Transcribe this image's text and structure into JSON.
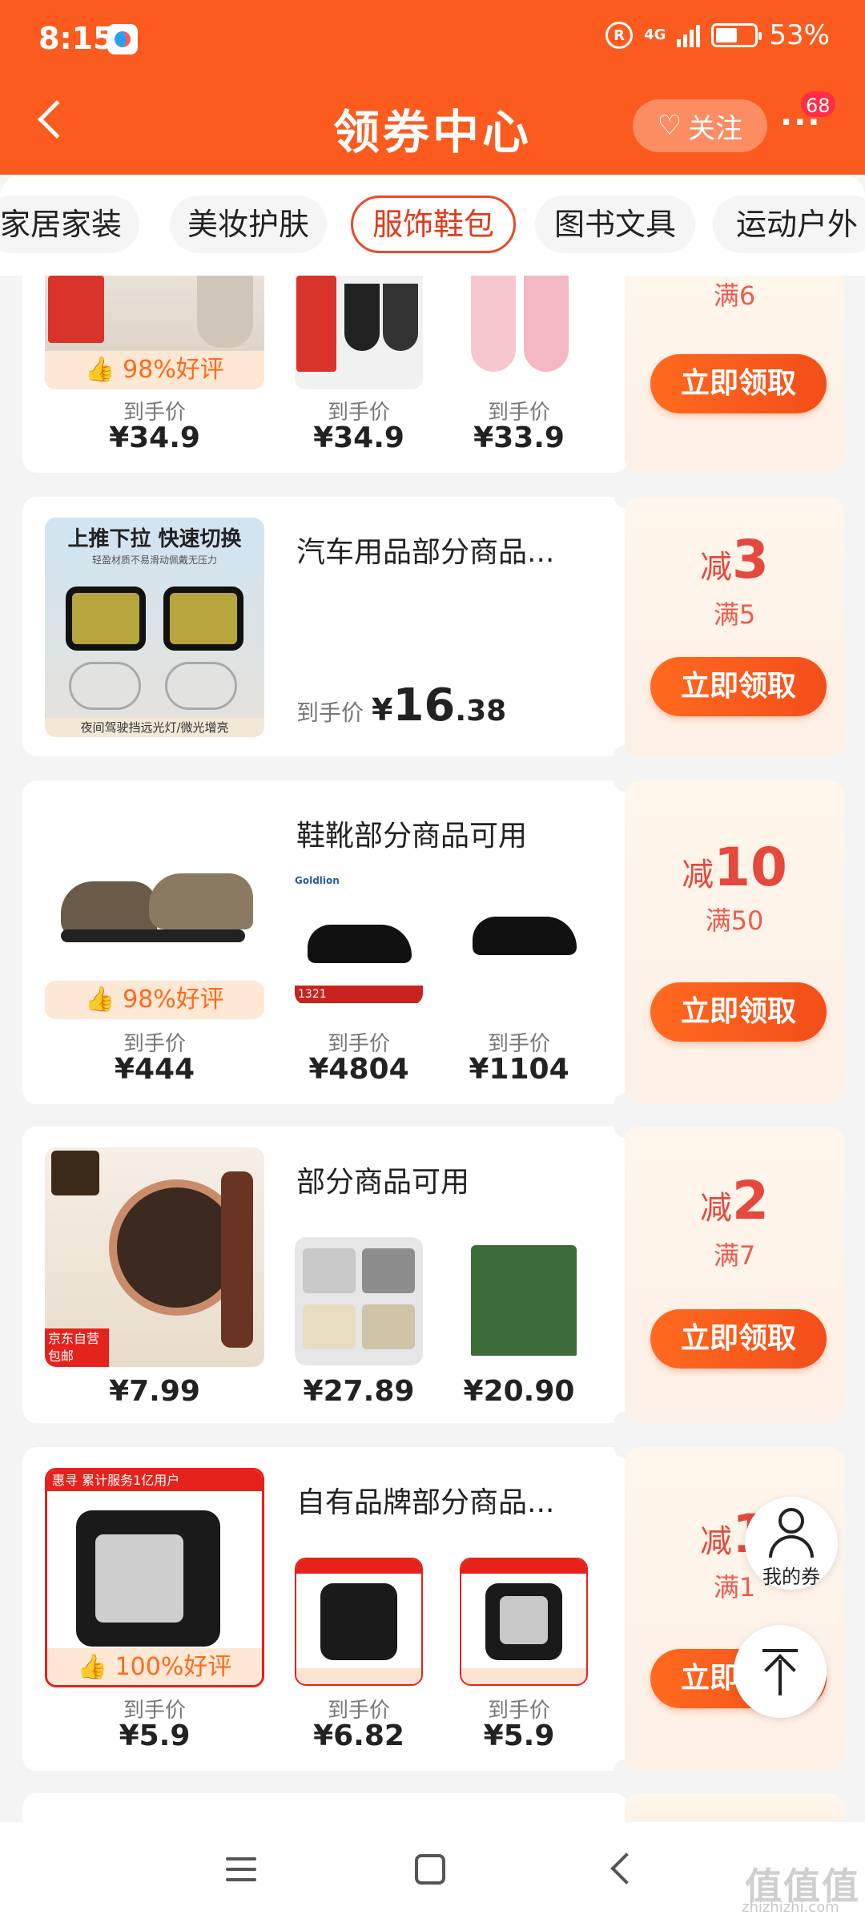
{
  "status_bar": {
    "time": "8:15",
    "network": "4G",
    "battery": "53%"
  },
  "header": {
    "title": "领券中心",
    "follow_label": "关注",
    "more_label": "···",
    "message_badge": "68"
  },
  "tabs": [
    {
      "label": "家居家装",
      "active": false
    },
    {
      "label": "美妆护肤",
      "active": false
    },
    {
      "label": "服饰鞋包",
      "active": true
    },
    {
      "label": "图书文具",
      "active": false
    },
    {
      "label": "运动户外",
      "active": false
    }
  ],
  "price_label": "到手价",
  "claim_label": "立即领取",
  "reduce_prefix": "减",
  "cards": [
    {
      "name": "",
      "products": [
        {
          "price": "¥34.9",
          "rating": "98%好评"
        },
        {
          "price": "¥34.9"
        },
        {
          "price": "¥33.9"
        }
      ],
      "coupon": {
        "amount": "",
        "threshold": "满6"
      }
    },
    {
      "name": "汽车用品部分商品...",
      "image_caption": "上推下拉 快速切换",
      "image_sub": "轻盈材质不易滑动佩戴无压力",
      "image_bottom": "夜间驾驶挡远光灯/微光增亮",
      "price_yen": "¥",
      "price_int": "16",
      "price_dec": ".38",
      "coupon": {
        "amount": "3",
        "threshold": "满5"
      }
    },
    {
      "name": "鞋靴部分商品可用",
      "products": [
        {
          "price": "¥444",
          "rating": "98%好评"
        },
        {
          "price": "¥4804"
        },
        {
          "price": "¥1104"
        }
      ],
      "coupon": {
        "amount": "10",
        "threshold": "满50"
      }
    },
    {
      "name": "部分商品可用",
      "products": [
        {
          "price": "¥7.99",
          "tag": "京东自营 包邮"
        },
        {
          "price": "¥27.89"
        },
        {
          "price": "¥20.90"
        }
      ],
      "coupon": {
        "amount": "2",
        "threshold": "满7"
      }
    },
    {
      "name": "自有品牌部分商品...",
      "banner": "惠寻",
      "banner_sub": "累计服务1亿用户",
      "products": [
        {
          "price": "¥5.9",
          "rating": "100%好评"
        },
        {
          "price": "¥6.82"
        },
        {
          "price": "¥5.9"
        }
      ],
      "coupon": {
        "amount": "1",
        "threshold": "满1"
      }
    }
  ],
  "floating": {
    "my_coupons": "我的券"
  },
  "watermark": {
    "main": "值值值",
    "sub": "zhizhizhi.com"
  },
  "colors": {
    "brand_orange": "#fb5b1f",
    "coupon_red": "#e4493d",
    "rating_orange": "#ff6a1a"
  }
}
